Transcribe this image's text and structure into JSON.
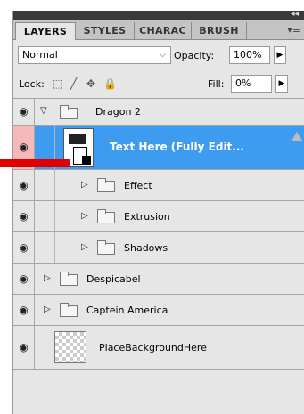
{
  "tabs": [
    {
      "label": "LAYERS"
    },
    {
      "label": "STYLES"
    },
    {
      "label": "CHARAC"
    },
    {
      "label": "BRUSH"
    }
  ],
  "blend_mode": {
    "value": "Normal"
  },
  "opacity": {
    "label": "Opacity:",
    "value": "100%"
  },
  "lock": {
    "label": "Lock:"
  },
  "fill": {
    "label": "Fill:",
    "value": "0%"
  },
  "layers": [
    {
      "name": "Dragon 2",
      "type": "group",
      "expanded": true
    },
    {
      "name": "Text Here (Fully Edit...",
      "type": "smart-object",
      "selected": true
    },
    {
      "name": "Effect",
      "type": "group"
    },
    {
      "name": "Extrusion",
      "type": "group"
    },
    {
      "name": "Shadows",
      "type": "group"
    },
    {
      "name": "Despicabel",
      "type": "group"
    },
    {
      "name": "Captein America",
      "type": "group"
    },
    {
      "name": "PlaceBackgroundHere",
      "type": "layer"
    }
  ],
  "colors": {
    "selection": "#3d9cf0",
    "annotation_arrow": "#e00000",
    "panel_bg": "#e6e6e6"
  },
  "icons": [
    "eye-icon",
    "folder-icon",
    "expand-triangle-icon",
    "lock-transparent-icon",
    "brush-icon",
    "move-icon",
    "lock-icon",
    "panel-menu-icon"
  ]
}
